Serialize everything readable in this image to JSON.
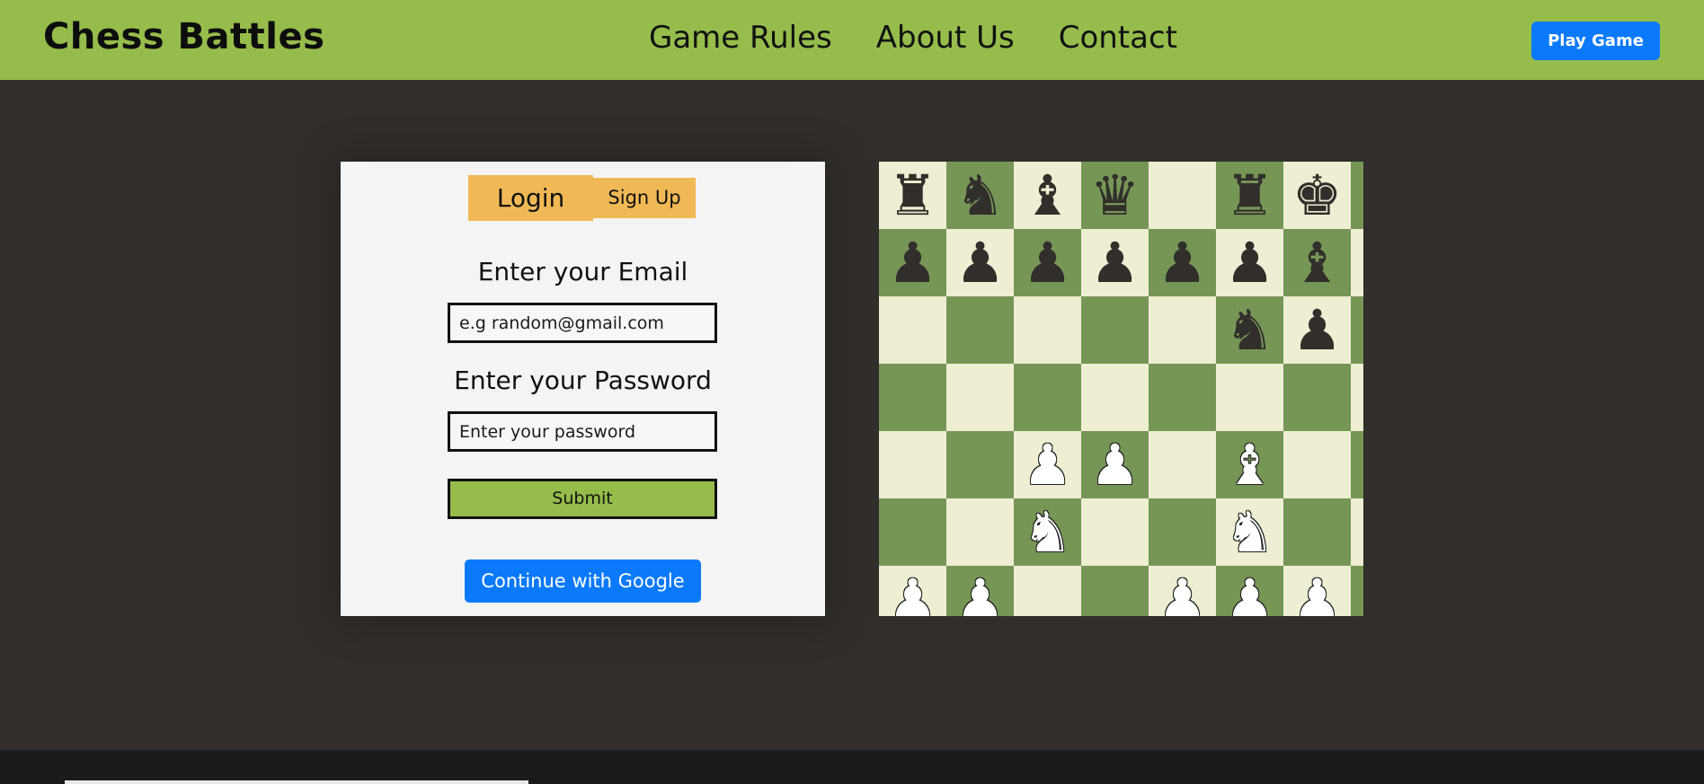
{
  "nav": {
    "brand": "Chess Battles",
    "links": [
      "Game Rules",
      "About Us",
      "Contact"
    ],
    "play_button": "Play Game"
  },
  "login": {
    "tab_login": "Login",
    "tab_signup": "Sign Up",
    "email_label": "Enter your Email",
    "email_placeholder": "e.g random@gmail.com",
    "password_label": "Enter your Password",
    "password_placeholder": "Enter your password",
    "submit_label": "Submit",
    "google_label": "Continue with Google"
  },
  "board": {
    "light_color": "#eeeed2",
    "dark_color": "#769656",
    "rows": [
      [
        "br",
        "bn",
        "bb",
        "bq",
        "",
        "br",
        "bk",
        ""
      ],
      [
        "bp",
        "bp",
        "bp",
        "bp",
        "bp",
        "bp",
        "bb",
        ""
      ],
      [
        "",
        "",
        "",
        "",
        "",
        "bn",
        "bp",
        ""
      ],
      [
        "",
        "",
        "",
        "",
        "",
        "",
        "",
        ""
      ],
      [
        "",
        "",
        "wp",
        "wp",
        "",
        "wb",
        "",
        ""
      ],
      [
        "",
        "",
        "wn",
        "",
        "",
        "wn",
        "",
        ""
      ],
      [
        "wp",
        "wp",
        "",
        "",
        "wp",
        "wp",
        "wp",
        ""
      ]
    ]
  },
  "colors": {
    "nav_bg": "#96bc4b",
    "page_bg": "#312e2b",
    "accent_blue": "#0b79fb",
    "tab_orange": "#f1b955"
  }
}
